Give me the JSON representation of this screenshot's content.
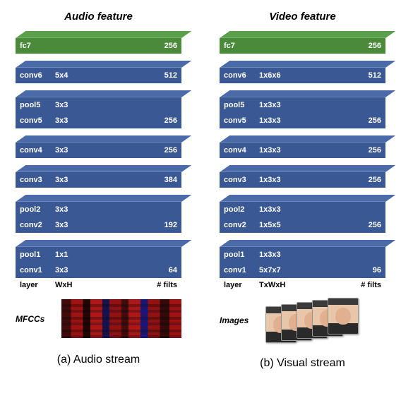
{
  "audio": {
    "title": "Audio feature",
    "headers": {
      "c1": "layer",
      "c2": "WxH",
      "c3": "# filts"
    },
    "input_label": "MFCCs",
    "layers": [
      {
        "type": "fc",
        "rows": [
          {
            "name": "fc7",
            "dim": "",
            "filts": "256"
          }
        ],
        "green": true
      },
      {
        "type": "single",
        "rows": [
          {
            "name": "conv6",
            "dim": "5x4",
            "filts": "512"
          }
        ]
      },
      {
        "type": "double",
        "rows": [
          {
            "name": "pool5",
            "dim": "3x3",
            "filts": ""
          },
          {
            "name": "conv5",
            "dim": "3x3",
            "filts": "256"
          }
        ]
      },
      {
        "type": "single",
        "rows": [
          {
            "name": "conv4",
            "dim": "3x3",
            "filts": "256"
          }
        ]
      },
      {
        "type": "single",
        "rows": [
          {
            "name": "conv3",
            "dim": "3x3",
            "filts": "384"
          }
        ]
      },
      {
        "type": "double",
        "rows": [
          {
            "name": "pool2",
            "dim": "3x3",
            "filts": ""
          },
          {
            "name": "conv2",
            "dim": "3x3",
            "filts": "192"
          }
        ]
      },
      {
        "type": "double",
        "rows": [
          {
            "name": "pool1",
            "dim": "1x1",
            "filts": ""
          },
          {
            "name": "conv1",
            "dim": "3x3",
            "filts": "64"
          }
        ]
      }
    ],
    "caption": "(a) Audio stream"
  },
  "video": {
    "title": "Video feature",
    "headers": {
      "c1": "layer",
      "c2": "TxWxH",
      "c3": "# filts"
    },
    "input_label": "Images",
    "layers": [
      {
        "type": "fc",
        "rows": [
          {
            "name": "fc7",
            "dim": "",
            "filts": "256"
          }
        ],
        "green": true
      },
      {
        "type": "single",
        "rows": [
          {
            "name": "conv6",
            "dim": "1x6x6",
            "filts": "512"
          }
        ]
      },
      {
        "type": "double",
        "rows": [
          {
            "name": "pool5",
            "dim": "1x3x3",
            "filts": ""
          },
          {
            "name": "conv5",
            "dim": "1x3x3",
            "filts": "256"
          }
        ]
      },
      {
        "type": "single",
        "rows": [
          {
            "name": "conv4",
            "dim": "1x3x3",
            "filts": "256"
          }
        ]
      },
      {
        "type": "single",
        "rows": [
          {
            "name": "conv3",
            "dim": "1x3x3",
            "filts": "256"
          }
        ]
      },
      {
        "type": "double",
        "rows": [
          {
            "name": "pool2",
            "dim": "1x3x3",
            "filts": ""
          },
          {
            "name": "conv2",
            "dim": "1x5x5",
            "filts": "256"
          }
        ]
      },
      {
        "type": "double",
        "rows": [
          {
            "name": "pool1",
            "dim": "1x3x3",
            "filts": ""
          },
          {
            "name": "conv1",
            "dim": "5x7x7",
            "filts": "96"
          }
        ]
      }
    ],
    "caption": "(b) Visual stream"
  },
  "chart_data": {
    "type": "table",
    "streams": [
      {
        "name": "Audio",
        "columns": [
          "layer",
          "WxH",
          "# filts"
        ],
        "rows": [
          [
            "fc7",
            "",
            "256"
          ],
          [
            "conv6",
            "5x4",
            "512"
          ],
          [
            "pool5",
            "3x3",
            ""
          ],
          [
            "conv5",
            "3x3",
            "256"
          ],
          [
            "conv4",
            "3x3",
            "256"
          ],
          [
            "conv3",
            "3x3",
            "384"
          ],
          [
            "pool2",
            "3x3",
            ""
          ],
          [
            "conv2",
            "3x3",
            "192"
          ],
          [
            "pool1",
            "1x1",
            ""
          ],
          [
            "conv1",
            "3x3",
            "64"
          ]
        ]
      },
      {
        "name": "Video",
        "columns": [
          "layer",
          "TxWxH",
          "# filts"
        ],
        "rows": [
          [
            "fc7",
            "",
            "256"
          ],
          [
            "conv6",
            "1x6x6",
            "512"
          ],
          [
            "pool5",
            "1x3x3",
            ""
          ],
          [
            "conv5",
            "1x3x3",
            "256"
          ],
          [
            "conv4",
            "1x3x3",
            "256"
          ],
          [
            "conv3",
            "1x3x3",
            "256"
          ],
          [
            "pool2",
            "1x3x3",
            ""
          ],
          [
            "conv2",
            "1x5x5",
            "256"
          ],
          [
            "pool1",
            "1x3x3",
            ""
          ],
          [
            "conv1",
            "5x7x7",
            "96"
          ]
        ]
      }
    ]
  }
}
